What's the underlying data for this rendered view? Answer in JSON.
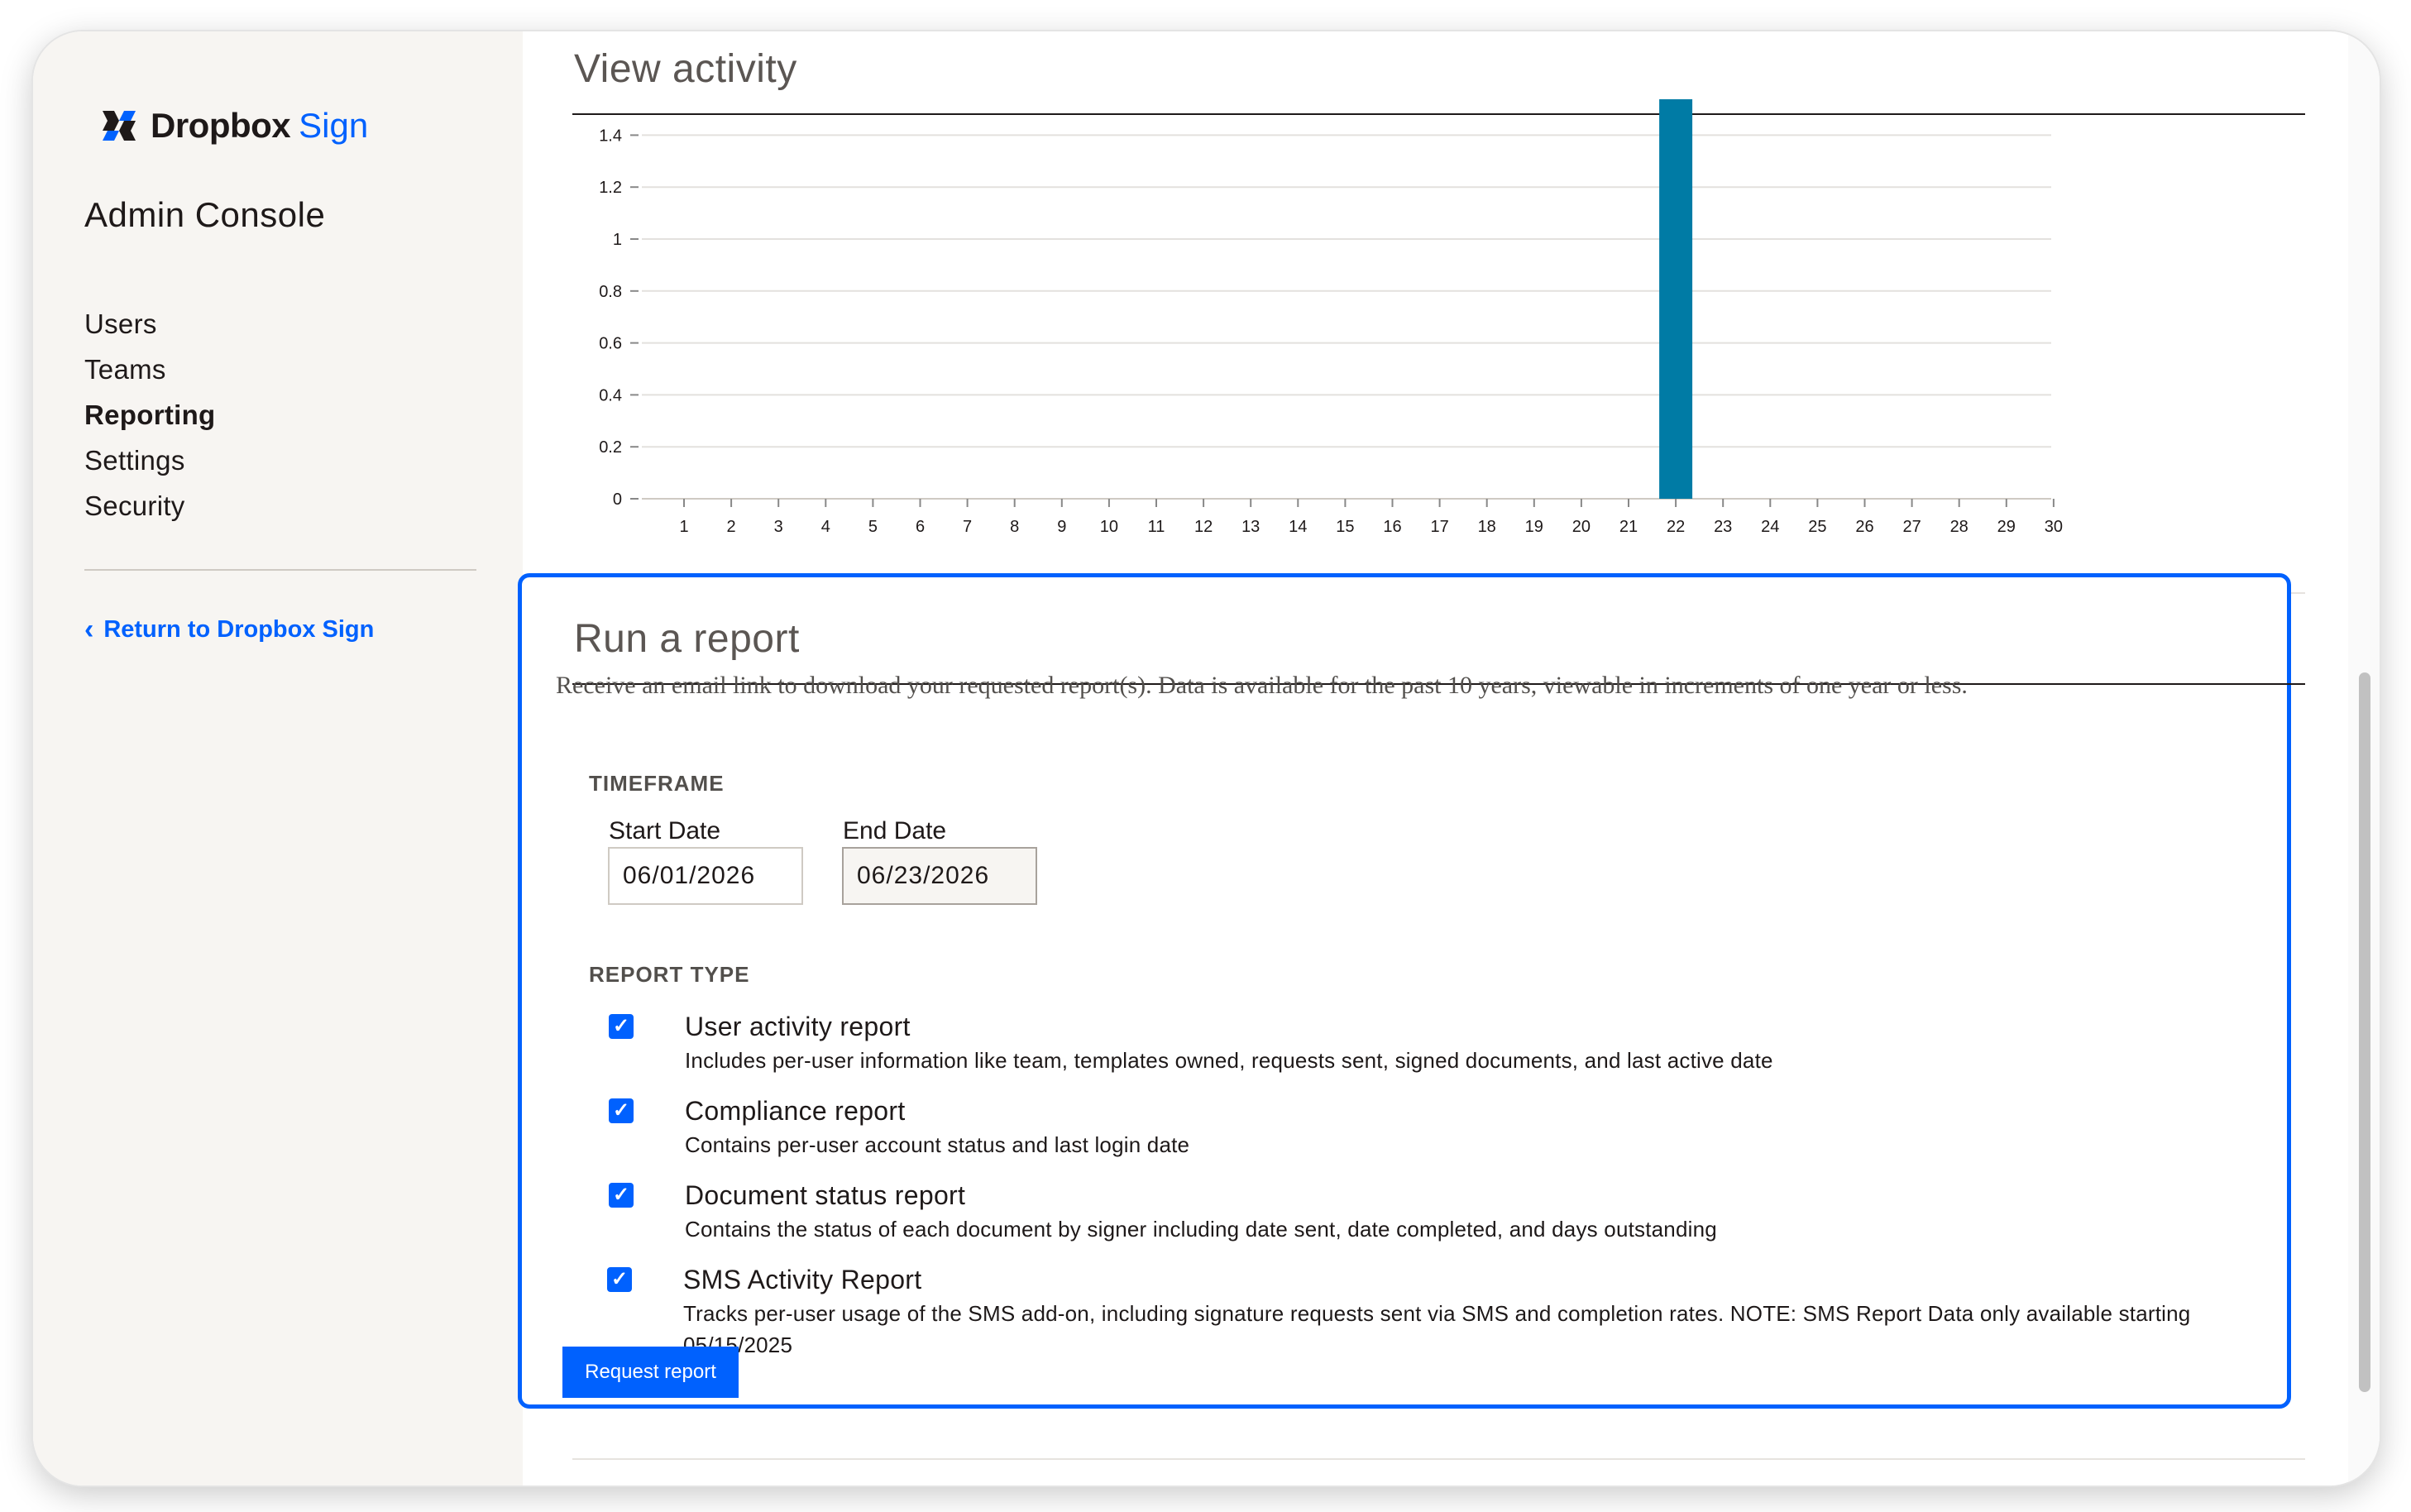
{
  "logo": {
    "word": "Dropbox",
    "sign": "Sign"
  },
  "sidebar": {
    "title": "Admin Console",
    "items": [
      {
        "label": "Users",
        "active": false
      },
      {
        "label": "Teams",
        "active": false
      },
      {
        "label": "Reporting",
        "active": true
      },
      {
        "label": "Settings",
        "active": false
      },
      {
        "label": "Security",
        "active": false
      }
    ],
    "return_link": "Return to Dropbox Sign"
  },
  "activity": {
    "title": "View activity",
    "chart_data": {
      "type": "bar",
      "categories": [
        "1",
        "2",
        "3",
        "4",
        "5",
        "6",
        "7",
        "8",
        "9",
        "10",
        "11",
        "12",
        "13",
        "14",
        "15",
        "16",
        "17",
        "18",
        "19",
        "20",
        "21",
        "22",
        "23",
        "24",
        "25",
        "26",
        "27",
        "28",
        "29",
        "30"
      ],
      "values": [
        0,
        0,
        0,
        0,
        0,
        0,
        0,
        0,
        0,
        0,
        0,
        0,
        0,
        0,
        0,
        0,
        0,
        0,
        0,
        0,
        0,
        1.5,
        0,
        0,
        0,
        0,
        0,
        0,
        0,
        0
      ],
      "yticks": [
        "0",
        "0.2",
        "0.4",
        "0.6",
        "0.8",
        "1",
        "1.2",
        "1.4"
      ],
      "ylim": [
        0,
        1.5
      ],
      "grid": true,
      "color": "#007ba5"
    }
  },
  "report": {
    "title": "Run a report",
    "description": "Receive an email link to download your requested report(s). Data is available for the past 10 years, viewable in increments of one year or less.",
    "timeframe_label": "TIMEFRAME",
    "start_label": "Start Date",
    "start_value": "06/01/2026",
    "end_label": "End Date",
    "end_value": "06/23/2026",
    "type_label": "REPORT TYPE",
    "options": [
      {
        "title": "User activity report",
        "desc": "Includes per-user information like team, templates owned, requests sent, signed documents, and last active date",
        "checked": true
      },
      {
        "title": "Compliance report",
        "desc": "Contains per-user account status and last login date",
        "checked": true
      },
      {
        "title": "Document status report",
        "desc": "Contains the status of each document by signer including date sent, date completed, and days outstanding",
        "checked": true
      },
      {
        "title": "SMS Activity Report",
        "desc": "Tracks per-user usage of the SMS add-on, including signature requests sent via SMS and completion rates. NOTE: SMS Report Data only available starting 05/15/2025",
        "checked": true
      }
    ],
    "button": "Request report"
  },
  "colors": {
    "accent": "#0061fe",
    "bar": "#007ba5"
  },
  "icons": {
    "logo": "dropbox-logo-icon",
    "back": "chevron-left-icon",
    "check": "checkmark-icon"
  }
}
